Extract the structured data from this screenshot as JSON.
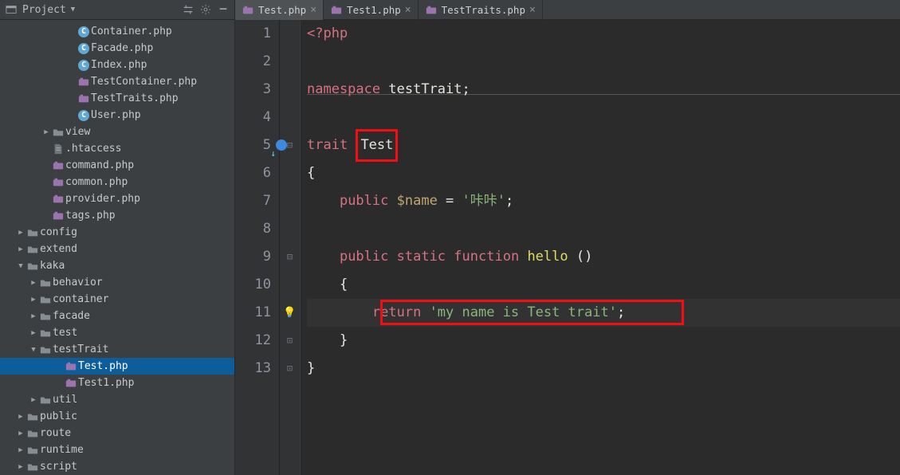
{
  "toolbar": {
    "project_label": "Project"
  },
  "tabs": [
    {
      "label": "Test.php",
      "active": true
    },
    {
      "label": "Test1.php",
      "active": false
    },
    {
      "label": "TestTraits.php",
      "active": false
    }
  ],
  "tree": [
    {
      "depth": 5,
      "kind": "c",
      "label": "Container.php",
      "tw": ""
    },
    {
      "depth": 5,
      "kind": "c",
      "label": "Facade.php",
      "tw": ""
    },
    {
      "depth": 5,
      "kind": "c",
      "label": "Index.php",
      "tw": ""
    },
    {
      "depth": 5,
      "kind": "php",
      "label": "TestContainer.php",
      "tw": ""
    },
    {
      "depth": 5,
      "kind": "php",
      "label": "TestTraits.php",
      "tw": ""
    },
    {
      "depth": 5,
      "kind": "c",
      "label": "User.php",
      "tw": ""
    },
    {
      "depth": 3,
      "kind": "folder",
      "label": "view",
      "tw": "▶"
    },
    {
      "depth": 3,
      "kind": "file",
      "label": ".htaccess",
      "tw": ""
    },
    {
      "depth": 3,
      "kind": "php",
      "label": "command.php",
      "tw": ""
    },
    {
      "depth": 3,
      "kind": "php",
      "label": "common.php",
      "tw": ""
    },
    {
      "depth": 3,
      "kind": "php",
      "label": "provider.php",
      "tw": ""
    },
    {
      "depth": 3,
      "kind": "php",
      "label": "tags.php",
      "tw": ""
    },
    {
      "depth": 1,
      "kind": "folder",
      "label": "config",
      "tw": "▶"
    },
    {
      "depth": 1,
      "kind": "folder",
      "label": "extend",
      "tw": "▶"
    },
    {
      "depth": 1,
      "kind": "folder",
      "label": "kaka",
      "tw": "▼"
    },
    {
      "depth": 2,
      "kind": "folder",
      "label": "behavior",
      "tw": "▶"
    },
    {
      "depth": 2,
      "kind": "folder",
      "label": "container",
      "tw": "▶"
    },
    {
      "depth": 2,
      "kind": "folder",
      "label": "facade",
      "tw": "▶"
    },
    {
      "depth": 2,
      "kind": "folder",
      "label": "test",
      "tw": "▶"
    },
    {
      "depth": 2,
      "kind": "folder",
      "label": "testTrait",
      "tw": "▼"
    },
    {
      "depth": 4,
      "kind": "php",
      "label": "Test.php",
      "tw": "",
      "selected": true
    },
    {
      "depth": 4,
      "kind": "php",
      "label": "Test1.php",
      "tw": ""
    },
    {
      "depth": 2,
      "kind": "folder",
      "label": "util",
      "tw": "▶"
    },
    {
      "depth": 1,
      "kind": "folder",
      "label": "public",
      "tw": "▶"
    },
    {
      "depth": 1,
      "kind": "folder",
      "label": "route",
      "tw": "▶"
    },
    {
      "depth": 1,
      "kind": "folder",
      "label": "runtime",
      "tw": "▶"
    },
    {
      "depth": 1,
      "kind": "folder",
      "label": "script",
      "tw": "▶"
    }
  ],
  "code": {
    "line_count": 13,
    "current_line": 11,
    "l1": {
      "open": "<?php"
    },
    "l3": {
      "kw": "namespace",
      "ns": "testTrait",
      "semi": ";"
    },
    "l5": {
      "kw": "trait",
      "name": "Test"
    },
    "l6": {
      "brace": "{"
    },
    "l7": {
      "kw": "public",
      "var": "$name",
      "eq": " = ",
      "str": "'咔咔'",
      "semi": ";"
    },
    "l9": {
      "kw1": "public",
      "kw2": "static",
      "kw3": "function",
      "fn": "hello",
      "paren": "()"
    },
    "l10": {
      "brace": "{"
    },
    "l11": {
      "kw": "return",
      "str": "'my name is Test trait'",
      "semi": ";"
    },
    "l12": {
      "brace": "}"
    },
    "l13": {
      "brace": "}"
    }
  },
  "highlights": {
    "box1": "trait-name",
    "box2": "return-statement"
  }
}
